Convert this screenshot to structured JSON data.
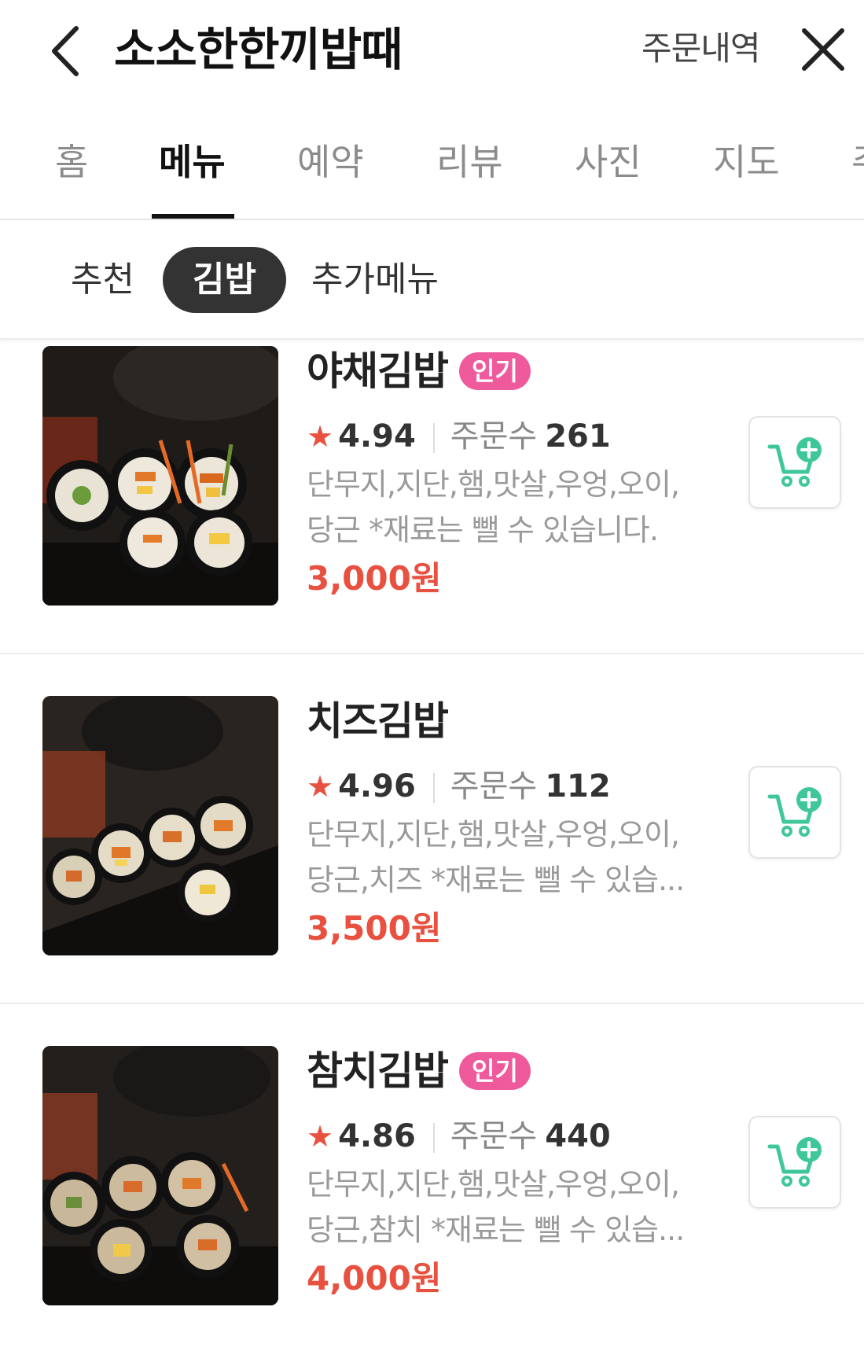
{
  "header": {
    "store_name": "소소한한끼밥때",
    "order_history_label": "주문내역"
  },
  "tabs": [
    {
      "label": "홈"
    },
    {
      "label": "메뉴"
    },
    {
      "label": "예약"
    },
    {
      "label": "리뷰"
    },
    {
      "label": "사진"
    },
    {
      "label": "지도"
    },
    {
      "label": "주"
    }
  ],
  "active_tab_index": 1,
  "subcategories": [
    {
      "label": "추천"
    },
    {
      "label": "김밥"
    },
    {
      "label": "추가메뉴"
    }
  ],
  "active_subcategory_index": 1,
  "menu_items": [
    {
      "name": "야채김밥",
      "badge": "인기",
      "rating": "4.94",
      "orders_label": "주문수",
      "orders_count": "261",
      "desc_line1": "단무지,지단,햄,맛살,우엉,오이,",
      "desc_line2": "당근 *재료는 뺄 수 있습니다.",
      "price": "3,000원"
    },
    {
      "name": "치즈김밥",
      "badge": "",
      "rating": "4.96",
      "orders_label": "주문수",
      "orders_count": "112",
      "desc_line1": "단무지,지단,햄,맛살,우엉,오이,",
      "desc_line2": "당근,치즈 *재료는 뺄 수 있습...",
      "price": "3,500원"
    },
    {
      "name": "참치김밥",
      "badge": "인기",
      "rating": "4.86",
      "orders_label": "주문수",
      "orders_count": "440",
      "desc_line1": "단무지,지단,햄,맛살,우엉,오이,",
      "desc_line2": "당근,참치 *재료는 뺄 수 있습...",
      "price": "4,000원"
    }
  ],
  "icons": {
    "back": "chevron-left-icon",
    "close": "close-icon",
    "star": "star-icon",
    "cart_add": "cart-add-icon"
  },
  "colors": {
    "accent_red": "#e8513f",
    "badge_pink": "#ef5a9c",
    "cart_green": "#3fc79a",
    "active_pill": "#333333"
  }
}
